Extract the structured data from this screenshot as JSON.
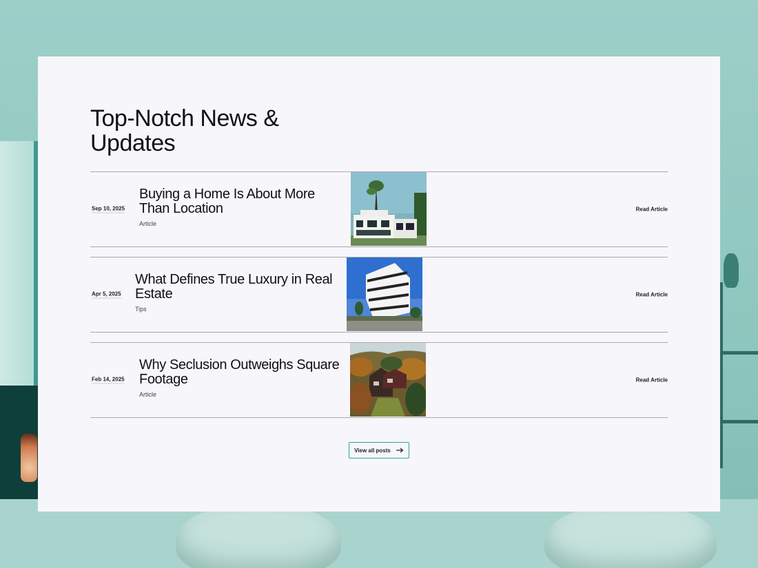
{
  "section": {
    "heading": "Top-Notch News & Updates"
  },
  "posts": [
    {
      "date": "Sep 10, 2025",
      "title": "Buying a Home Is About More Than Location",
      "category": "Article",
      "read_label": "Read Article",
      "image": "modern-white-villa-with-palm-trees"
    },
    {
      "date": "Apr 5, 2025",
      "title": "What Defines True Luxury in Real Estate",
      "category": "Tips",
      "read_label": "Read Article",
      "image": "white-apartment-tower-blue-sky"
    },
    {
      "date": "Feb 14, 2025",
      "title": "Why Seclusion Outweighs Square Footage",
      "category": "Article",
      "read_label": "Read Article",
      "image": "house-in-autumn-forest-aerial"
    }
  ],
  "view_all": {
    "label": "View all posts",
    "icon": "arrow-right-icon"
  },
  "colors": {
    "accent": "#2aa89a",
    "card_bg": "#f7f6fb",
    "background_tint": "#8cc4bd"
  }
}
